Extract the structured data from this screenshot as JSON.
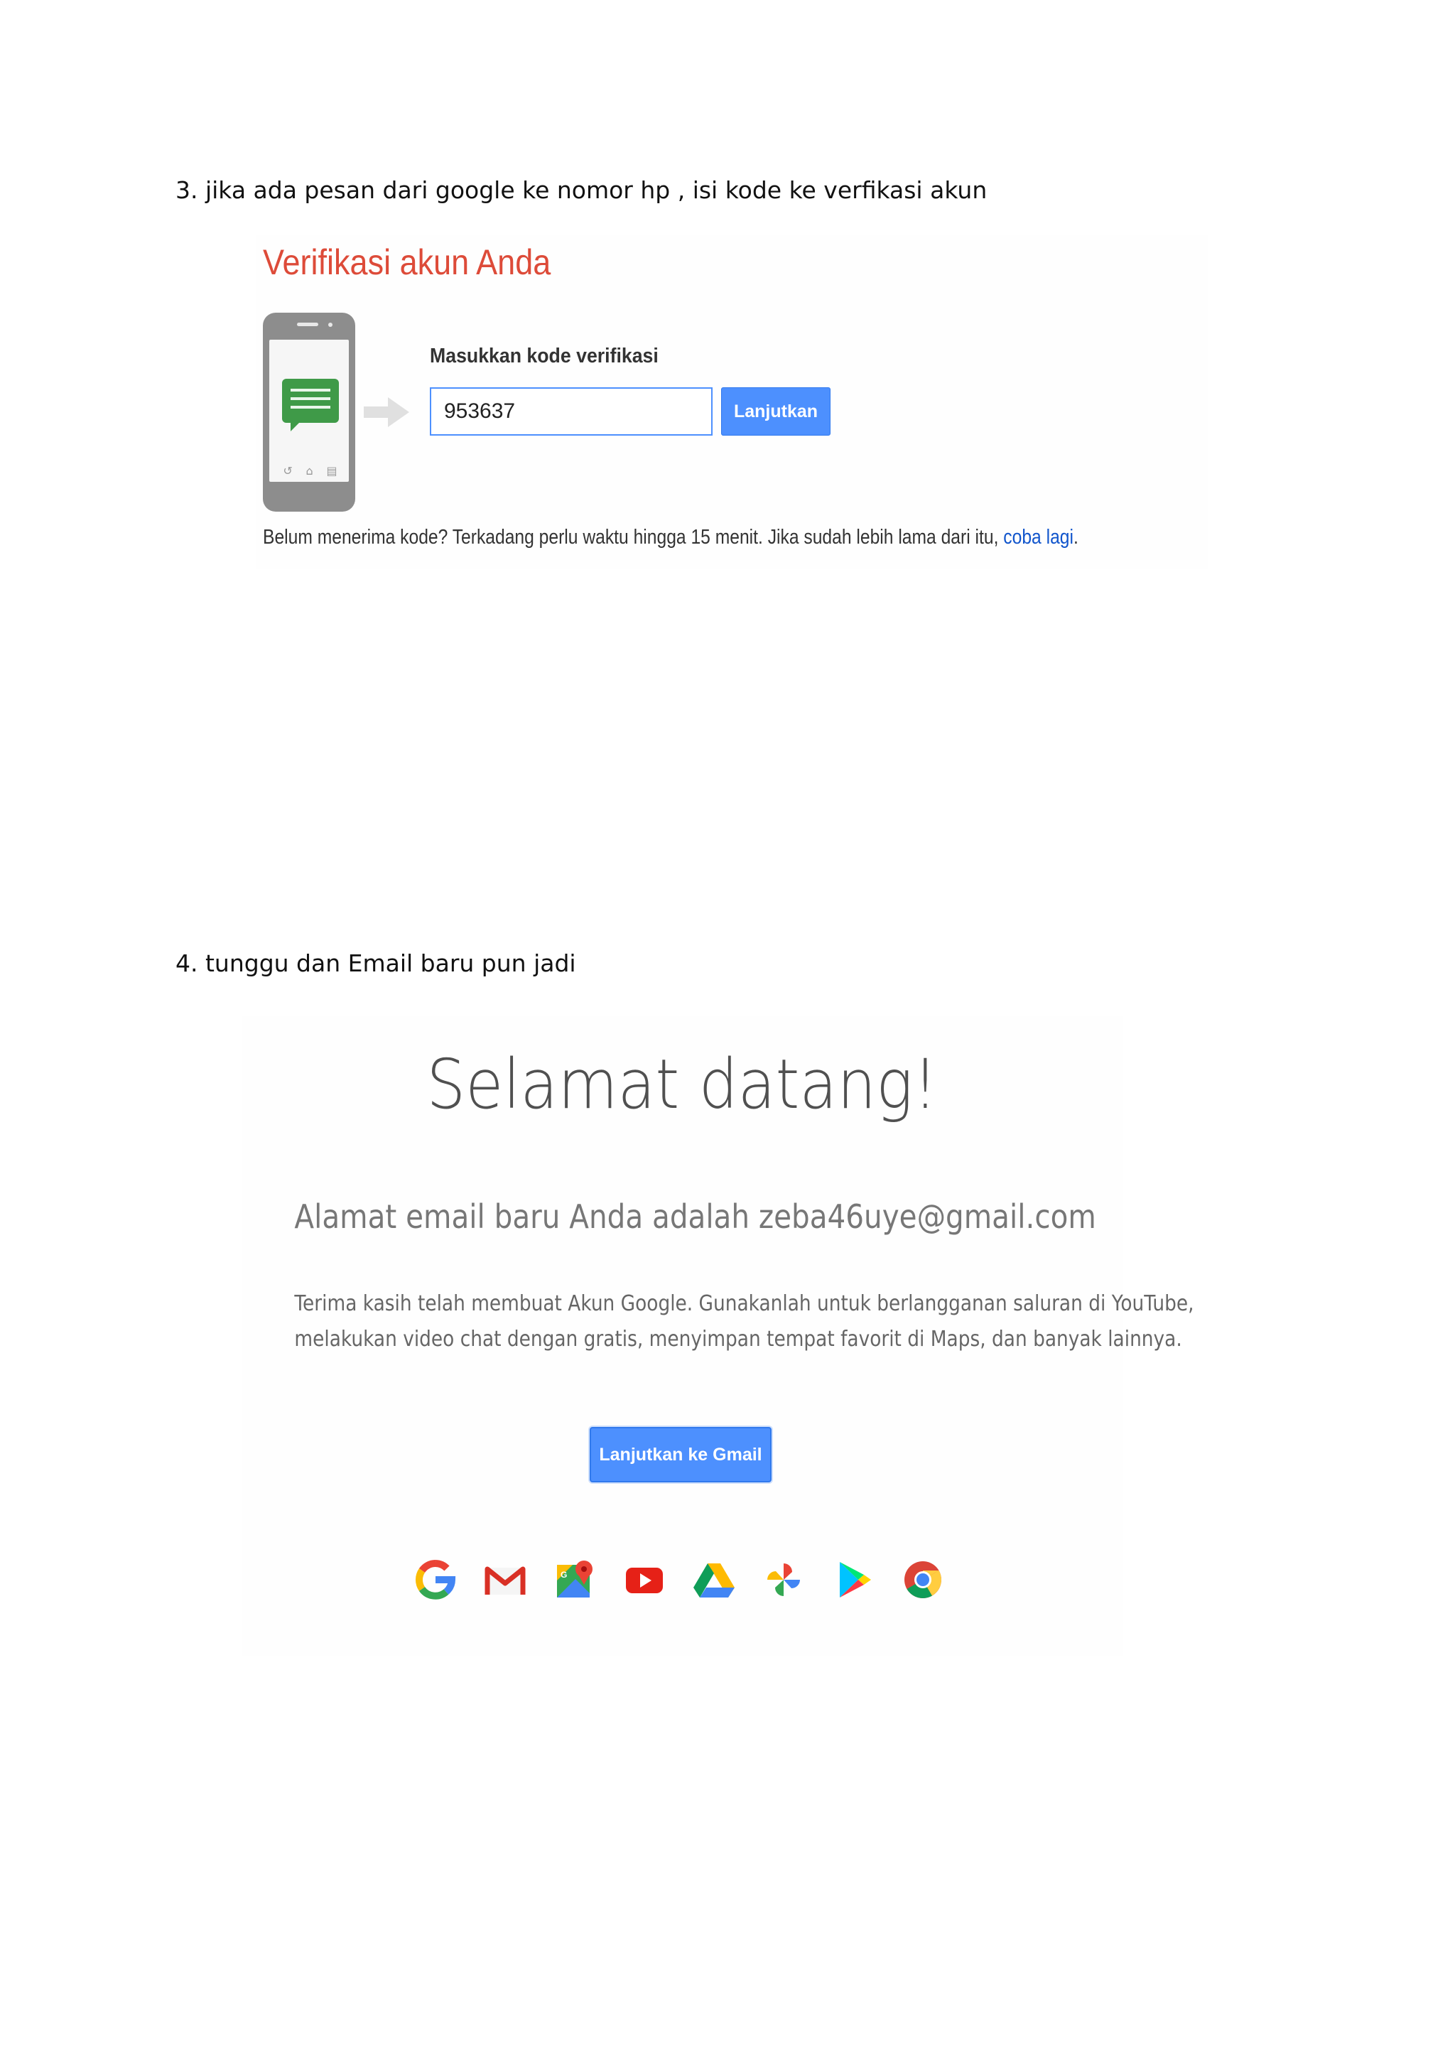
{
  "document": {
    "step3_instruction": "3. jika ada pesan dari google ke nomor hp , isi kode ke verfikasi akun",
    "step4_instruction": "4. tunggu dan Email baru pun jadi"
  },
  "verification": {
    "title": "Verifikasi akun Anda",
    "code_label": "Masukkan kode verifikasi",
    "code_value": "953637",
    "continue_button": "Lanjutkan",
    "resend_text": "Belum menerima kode? Terkadang perlu waktu hingga 15 menit. Jika sudah lebih lama dari itu, ",
    "resend_link": "coba lagi",
    "resend_end": "."
  },
  "welcome": {
    "title": "Selamat datang!",
    "email_line": "Alamat email baru Anda adalah zeba46uye@gmail.com",
    "body_line1": "Terima kasih telah membuat Akun Google. Gunakanlah untuk berlangganan saluran di YouTube,",
    "body_line2": "melakukan video chat dengan gratis, menyimpan tempat favorit di Maps, dan banyak lainnya.",
    "gmail_button": "Lanjutkan ke Gmail",
    "app_icons": [
      "google-g-icon",
      "gmail-icon",
      "maps-icon",
      "youtube-icon",
      "drive-icon",
      "photos-icon",
      "play-icon",
      "chrome-icon"
    ]
  },
  "colors": {
    "title_red": "#dd4b39",
    "button_blue": "#4d90fe",
    "link_blue": "#1155cc",
    "message_green": "#3f9a48"
  }
}
